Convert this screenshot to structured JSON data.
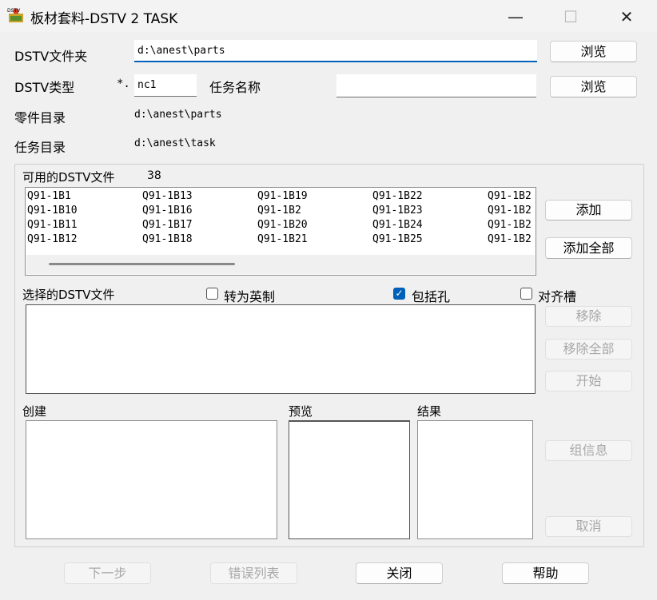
{
  "window": {
    "title": "板材套料-DSTV 2 TASK",
    "minimize_glyph": "—",
    "maximize_glyph": "☐",
    "close_glyph": "✕",
    "icon_text": "DSTV"
  },
  "form": {
    "folder_label": "DSTV文件夹",
    "folder_value": "d:\\anest\\parts",
    "browse1_label": "浏览",
    "type_label": "DSTV类型",
    "type_prefix": "*.",
    "type_value": "nc1",
    "task_name_label": "任务名称",
    "task_name_value": "",
    "browse2_label": "浏览",
    "parts_dir_label": "零件目录",
    "parts_dir_value": "d:\\anest\\parts",
    "task_dir_label": "任务目录",
    "task_dir_value": "d:\\anest\\task"
  },
  "available": {
    "label": "可用的DSTV文件",
    "count": "38",
    "columns": [
      [
        "Q91-1B1",
        "Q91-1B10",
        "Q91-1B11",
        "Q91-1B12"
      ],
      [
        "Q91-1B13",
        "Q91-1B16",
        "Q91-1B17",
        "Q91-1B18"
      ],
      [
        "Q91-1B19",
        "Q91-1B2",
        "Q91-1B20",
        "Q91-1B21"
      ],
      [
        "Q91-1B22",
        "Q91-1B23",
        "Q91-1B24",
        "Q91-1B25"
      ],
      [
        "Q91-1B2",
        "Q91-1B2",
        "Q91-1B2",
        "Q91-1B2"
      ]
    ],
    "add_label": "添加",
    "add_all_label": "添加全部"
  },
  "selected": {
    "label": "选择的DSTV文件",
    "to_imperial_label": "转为英制",
    "to_imperial_checked": false,
    "include_holes_label": "包括孔",
    "include_holes_checked": true,
    "align_slots_label": "对齐槽",
    "align_slots_checked": false,
    "remove_label": "移除",
    "remove_all_label": "移除全部",
    "start_label": "开始"
  },
  "bottom": {
    "create_label": "创建",
    "preview_label": "预览",
    "result_label": "结果",
    "group_info_label": "组信息",
    "cancel_label": "取消"
  },
  "footer": {
    "next_label": "下一步",
    "error_list_label": "错误列表",
    "close_label": "关闭",
    "help_label": "帮助"
  }
}
